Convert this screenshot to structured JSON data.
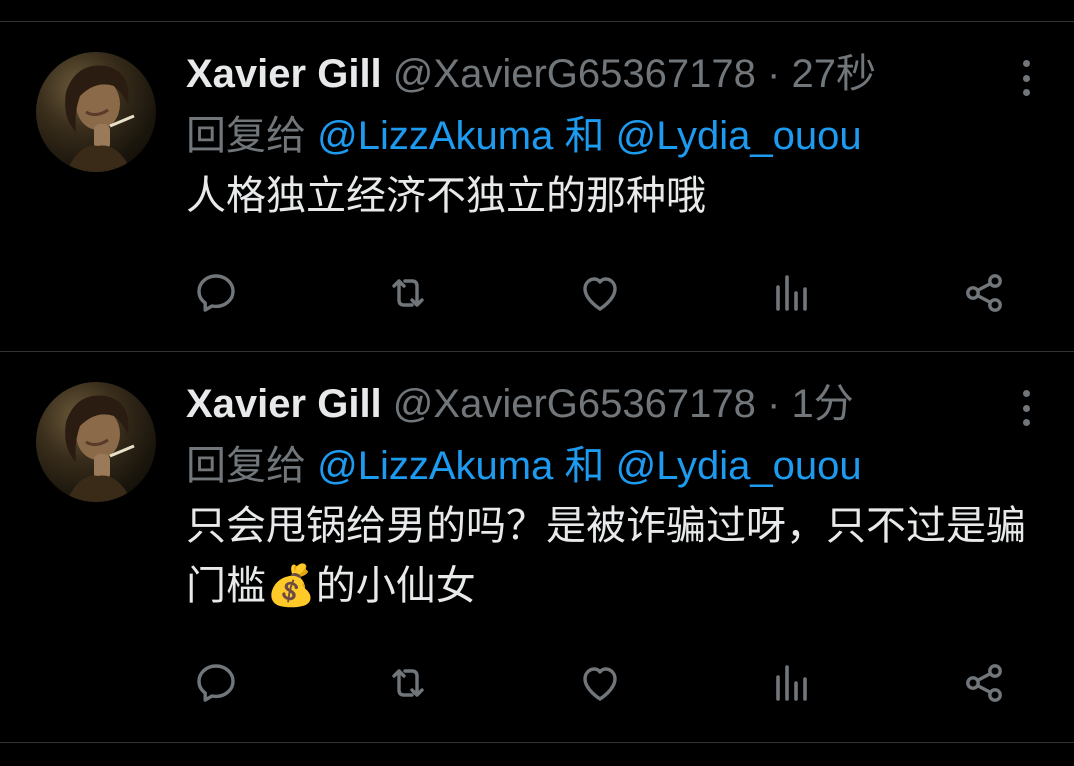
{
  "tweets": [
    {
      "author_name": "Xavier Gill",
      "handle": "@XavierG65367178",
      "separator": "·",
      "time": "27秒",
      "reply_prefix": "回复给",
      "reply_to_1": "@LizzAkuma",
      "reply_and": "和",
      "reply_to_2": "@Lydia_ouou",
      "text": "人格独立经济不独立的那种哦"
    },
    {
      "author_name": "Xavier Gill",
      "handle": "@XavierG65367178",
      "separator": "·",
      "time": "1分",
      "reply_prefix": "回复给",
      "reply_to_1": "@LizzAkuma",
      "reply_and": "和",
      "reply_to_2": "@Lydia_ouou",
      "text": "只会甩锅给男的吗？是被诈骗过呀，只不过是骗门槛💰的小仙女"
    }
  ],
  "colors": {
    "background": "#000000",
    "divider": "#2f3336",
    "primary_text": "#e7e9ea",
    "secondary_text": "#71767b",
    "link": "#1d9bf0"
  },
  "icons": {
    "reply": "reply-icon",
    "retweet": "retweet-icon",
    "like": "heart-icon",
    "views": "views-icon",
    "share": "share-icon",
    "more": "more-dots-icon"
  }
}
